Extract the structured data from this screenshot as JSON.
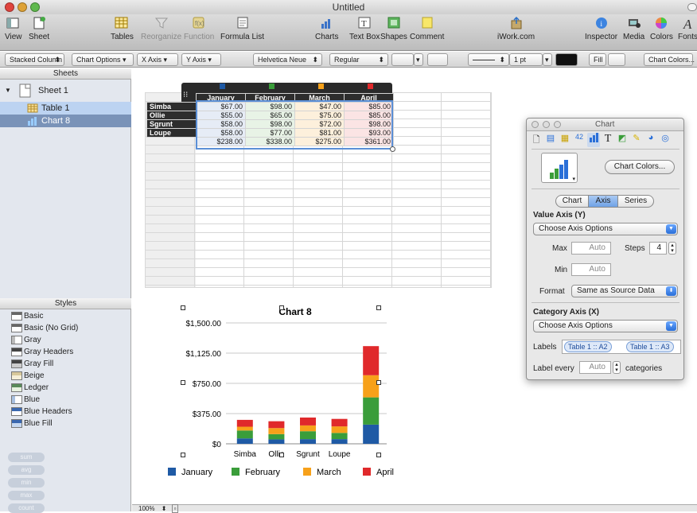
{
  "window": {
    "title": "Untitled"
  },
  "toolbar": {
    "view": "View",
    "sheet": "Sheet",
    "tables": "Tables",
    "reorganize": "Reorganize",
    "function": "Function",
    "formula_list": "Formula List",
    "charts": "Charts",
    "text_box": "Text Box",
    "shapes": "Shapes",
    "comment": "Comment",
    "iwork": "iWork.com",
    "inspector": "Inspector",
    "media": "Media",
    "colors": "Colors",
    "fonts": "Fonts"
  },
  "formatbar": {
    "chart_type": "Stacked Column",
    "chart_options": "Chart Options",
    "x_axis": "X Axis",
    "y_axis": "Y Axis",
    "font": "Helvetica Neue",
    "font_style": "Regular",
    "stroke_width": "1 pt",
    "fill": "Fill",
    "chart_colors": "Chart Colors..."
  },
  "sidebar": {
    "sheets_header": "Sheets",
    "sheet": "Sheet 1",
    "items": [
      {
        "label": "Table 1"
      },
      {
        "label": "Chart 8"
      }
    ],
    "styles_header": "Styles",
    "styles": [
      "Basic",
      "Basic (No Grid)",
      "Gray",
      "Gray Headers",
      "Gray Fill",
      "Beige",
      "Ledger",
      "Blue",
      "Blue Headers",
      "Blue Fill"
    ],
    "functions": [
      "sum",
      "avg",
      "min",
      "max",
      "count"
    ]
  },
  "table": {
    "columns": [
      "January",
      "February",
      "March",
      "April"
    ],
    "rows": [
      {
        "name": "Simba",
        "values": [
          "$67.00",
          "$98.00",
          "$47.00",
          "$85.00"
        ]
      },
      {
        "name": "Ollie",
        "values": [
          "$55.00",
          "$65.00",
          "$75.00",
          "$85.00"
        ]
      },
      {
        "name": "Sgrunt",
        "values": [
          "$58.00",
          "$98.00",
          "$72.00",
          "$98.00"
        ]
      },
      {
        "name": "Loupe",
        "values": [
          "$58.00",
          "$77.00",
          "$81.00",
          "$93.00"
        ]
      }
    ],
    "totals": [
      "$238.00",
      "$338.00",
      "$275.00",
      "$361.00"
    ]
  },
  "colors": {
    "january": "#1f5aa5",
    "february": "#3a9d3a",
    "march": "#f7a11a",
    "april": "#e0292b"
  },
  "chart_data": {
    "type": "bar",
    "stacked": true,
    "title": "Chart 8",
    "categories": [
      "Simba",
      "Ollie",
      "Sgrunt",
      "Loupe",
      ""
    ],
    "series": [
      {
        "name": "January",
        "values": [
          67,
          55,
          58,
          58,
          238
        ]
      },
      {
        "name": "February",
        "values": [
          98,
          65,
          98,
          77,
          338
        ]
      },
      {
        "name": "March",
        "values": [
          47,
          75,
          72,
          81,
          275
        ]
      },
      {
        "name": "April",
        "values": [
          85,
          85,
          98,
          93,
          361
        ]
      }
    ],
    "ylim": [
      0,
      1500
    ],
    "yticks": [
      "$0",
      "$375.00",
      "$750.00",
      "$1,125.00",
      "$1,500.00"
    ],
    "grid": true,
    "legend": "bottom"
  },
  "inspector": {
    "title": "Chart",
    "chart_colors": "Chart Colors...",
    "tabs": [
      "Chart",
      "Axis",
      "Series"
    ],
    "value_axis": "Value Axis (Y)",
    "axis_options": "Choose Axis Options",
    "max": "Max",
    "max_value": "Auto",
    "steps": "Steps",
    "steps_value": "4",
    "min": "Min",
    "min_value": "Auto",
    "format": "Format",
    "format_value": "Same as Source Data",
    "category_axis": "Category Axis (X)",
    "axis_options2": "Choose Axis Options",
    "labels": "Labels",
    "label_token1": "Table 1 :: A2",
    "label_token2": "Table 1 :: A3",
    "label_every": "Label every",
    "label_every_value": "Auto",
    "categories": "categories"
  },
  "status": {
    "zoom": "100%"
  }
}
